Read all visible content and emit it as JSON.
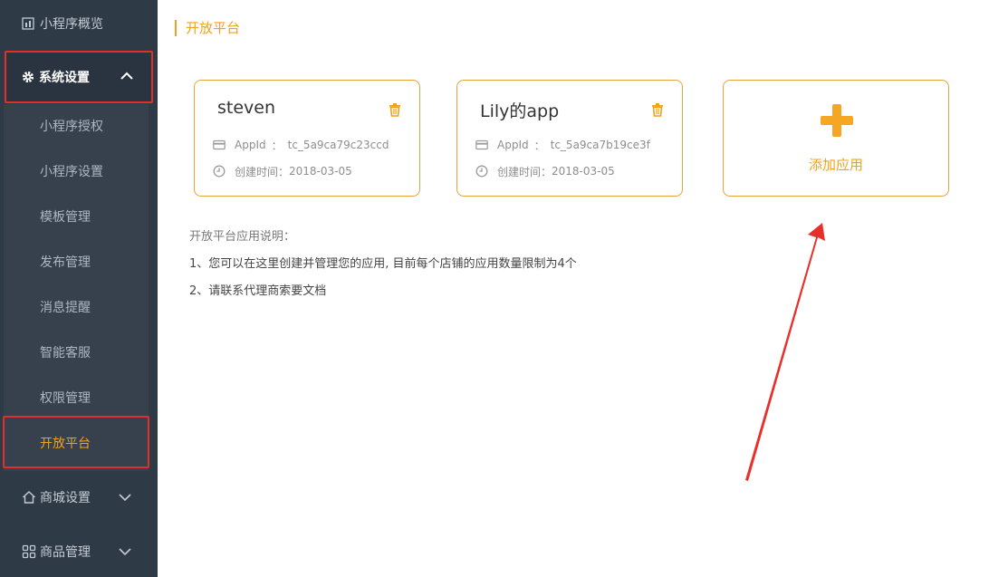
{
  "sidebar": {
    "top_item": {
      "label": "小程序概览",
      "icon": "chart-icon"
    },
    "group": {
      "label": "系统设置",
      "icon": "gear-icon",
      "expanded": true
    },
    "sub_items": [
      {
        "label": "小程序授权",
        "active": false
      },
      {
        "label": "小程序设置",
        "active": false
      },
      {
        "label": "模板管理",
        "active": false
      },
      {
        "label": "发布管理",
        "active": false
      },
      {
        "label": "消息提醒",
        "active": false
      },
      {
        "label": "智能客服",
        "active": false
      },
      {
        "label": "权限管理",
        "active": false
      },
      {
        "label": "开放平台",
        "active": true
      }
    ],
    "bottom_items": [
      {
        "label": "商城设置",
        "icon": "home-icon"
      },
      {
        "label": "商品管理",
        "icon": "grid-icon"
      }
    ]
  },
  "main": {
    "breadcrumb": "开放平台",
    "apps": [
      {
        "name": "steven",
        "appid_label": "AppId",
        "appid_colon": "：",
        "appid": "tc_5a9ca79c23ccd",
        "created_label": "创建时间：",
        "created": "2018-03-05"
      },
      {
        "name": "Lily的app",
        "appid_label": "AppId",
        "appid_colon": "：",
        "appid": "tc_5a9ca7b19ce3f",
        "created_label": "创建时间：",
        "created": "2018-03-05"
      }
    ],
    "add_app_label": "添加应用",
    "info": {
      "title": "开放平台应用说明：",
      "lines": [
        "1、您可以在这里创建并管理您的应用, 目前每个店铺的应用数量限制为4个",
        "2、请联系代理商索要文档"
      ]
    }
  },
  "colors": {
    "sidebar_bg": "#2f3a47",
    "accent": "#f0a21b",
    "highlight_red": "#e0302e"
  }
}
